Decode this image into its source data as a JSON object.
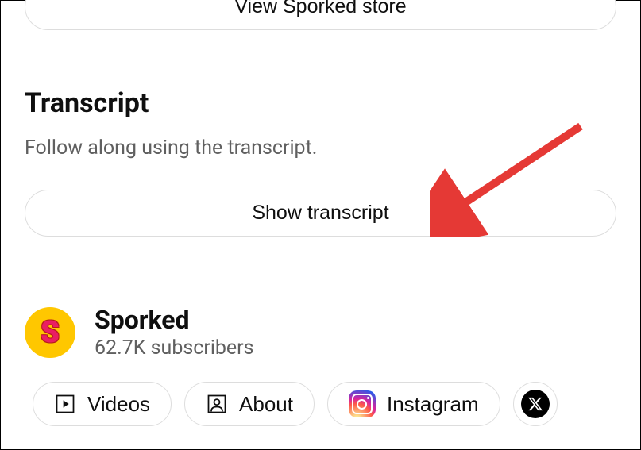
{
  "store": {
    "view_label": "View Sporked store"
  },
  "transcript": {
    "heading": "Transcript",
    "description": "Follow along using the transcript.",
    "show_label": "Show transcript"
  },
  "channel": {
    "name": "Sporked",
    "avatar_letter": "S",
    "subscribers": "62.7K subscribers"
  },
  "links": {
    "videos": "Videos",
    "about": "About",
    "instagram": "Instagram"
  }
}
